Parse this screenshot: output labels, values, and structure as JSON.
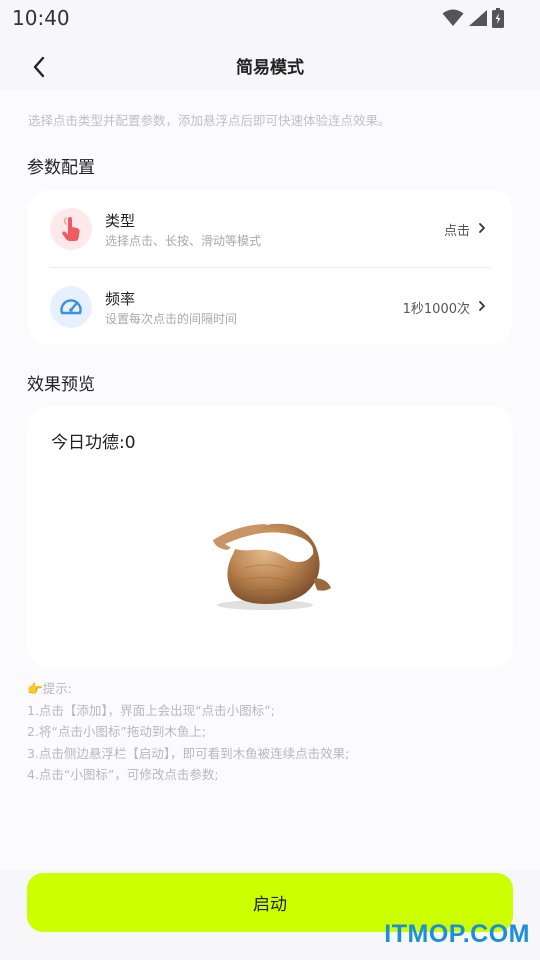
{
  "status_bar": {
    "time": "10:40"
  },
  "nav": {
    "title": "简易模式"
  },
  "hint": "选择点击类型并配置参数，添加悬浮点后即可快速体验连点效果。",
  "config": {
    "section_title": "参数配置",
    "rows": [
      {
        "title": "类型",
        "subtitle": "选择点击、长按、滑动等模式",
        "value": "点击",
        "icon": "pointer-hand-icon",
        "icon_bg": "#fde9ea",
        "icon_color": "#f05a62"
      },
      {
        "title": "频率",
        "subtitle": "设置每次点击的间隔时间",
        "value": "1秒1000次",
        "icon": "speedometer-icon",
        "icon_bg": "#e7f1fd",
        "icon_color": "#3b8fe8"
      }
    ]
  },
  "preview": {
    "section_title": "效果预览",
    "merit": "今日功德:0"
  },
  "tips": {
    "header": "👉提示:",
    "items": [
      "1.点击【添加】，界面上会出现“点击小图标”;",
      "2.将“点击小图标”拖动到木鱼上;",
      "3.点击侧边悬浮栏【启动】，即可看到木鱼被连续点击效果;",
      "4.点击“小图标”，可修改点击参数;"
    ]
  },
  "start_button": {
    "label": "启动",
    "color": "#ccff00"
  },
  "watermark": "ITMOP.COM"
}
